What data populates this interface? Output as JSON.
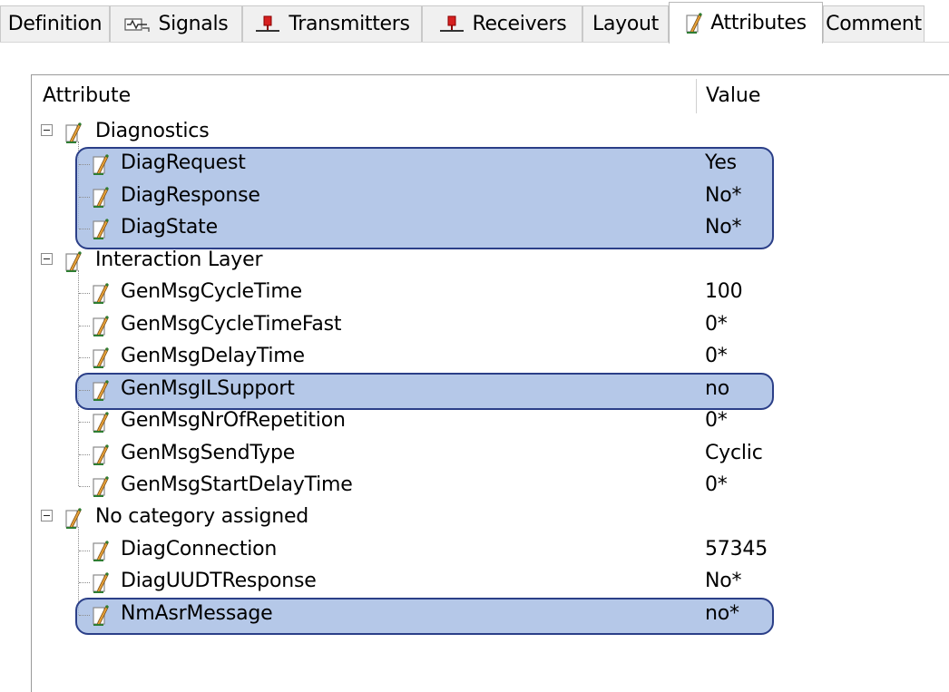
{
  "tabs": [
    {
      "label": "Definition",
      "icon": null,
      "active": false
    },
    {
      "label": "Signals",
      "icon": "signal-waveform-icon",
      "active": false
    },
    {
      "label": "Transmitters",
      "icon": "transmitter-node-icon",
      "active": false
    },
    {
      "label": "Receivers",
      "icon": "receiver-node-icon",
      "active": false
    },
    {
      "label": "Layout",
      "icon": null,
      "active": false
    },
    {
      "label": "Attributes",
      "icon": "attribute-edit-icon",
      "active": true
    },
    {
      "label": "Comment",
      "icon": null,
      "active": false
    }
  ],
  "columns": {
    "attribute": "Attribute",
    "value": "Value"
  },
  "groups": [
    {
      "label": "Diagnostics",
      "items": [
        {
          "name": "DiagRequest",
          "value": "Yes",
          "highlighted": true
        },
        {
          "name": "DiagResponse",
          "value": "No*",
          "highlighted": true
        },
        {
          "name": "DiagState",
          "value": "No*",
          "highlighted": true
        }
      ]
    },
    {
      "label": "Interaction Layer",
      "items": [
        {
          "name": "GenMsgCycleTime",
          "value": "100",
          "highlighted": false
        },
        {
          "name": "GenMsgCycleTimeFast",
          "value": "0*",
          "highlighted": false
        },
        {
          "name": "GenMsgDelayTime",
          "value": "0*",
          "highlighted": false
        },
        {
          "name": "GenMsgILSupport",
          "value": "no",
          "highlighted": true
        },
        {
          "name": "GenMsgNrOfRepetition",
          "value": "0*",
          "highlighted": false
        },
        {
          "name": "GenMsgSendType",
          "value": "Cyclic",
          "highlighted": false
        },
        {
          "name": "GenMsgStartDelayTime",
          "value": "0*",
          "highlighted": false
        }
      ]
    },
    {
      "label": "No category assigned",
      "items": [
        {
          "name": "DiagConnection",
          "value": "57345",
          "highlighted": false
        },
        {
          "name": "DiagUUDTResponse",
          "value": "No*",
          "highlighted": false
        },
        {
          "name": "NmAsrMessage",
          "value": "no*",
          "highlighted": true
        }
      ]
    }
  ],
  "colors": {
    "highlight_fill": "#a0b9e2",
    "highlight_border": "#2b3f88",
    "icon_accent": "#2e7d32",
    "node_red": "#d62020"
  }
}
